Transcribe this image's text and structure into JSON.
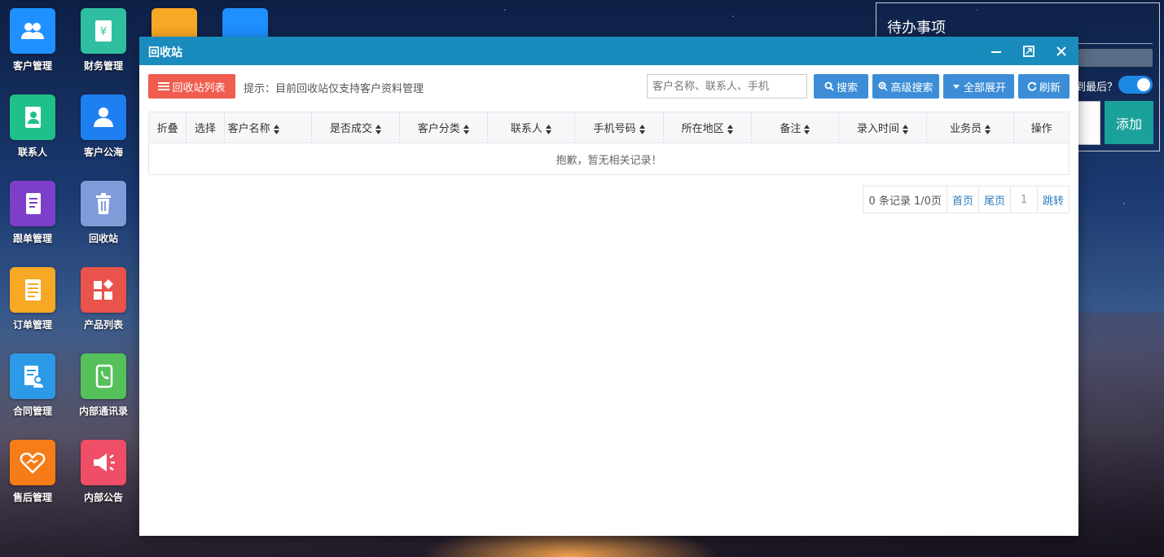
{
  "desktop": {
    "icons": [
      {
        "label": "客户管理",
        "icon": "customers-icon",
        "color": "#1e90ff"
      },
      {
        "label": "财务管理",
        "icon": "finance-icon",
        "color": "#2fbfa0"
      },
      {
        "label": "联系人",
        "icon": "contacts-icon",
        "color": "#20c08a"
      },
      {
        "label": "客户公海",
        "icon": "customer-pool-icon",
        "color": "#1e7ff0"
      },
      {
        "label": "跟单管理",
        "icon": "follow-up-icon",
        "color": "#7d3fc9"
      },
      {
        "label": "回收站",
        "icon": "trash-icon",
        "color": "#7e9cd8"
      },
      {
        "label": "订单管理",
        "icon": "orders-icon",
        "color": "#f7a825"
      },
      {
        "label": "产品列表",
        "icon": "products-icon",
        "color": "#e9534b"
      },
      {
        "label": "合同管理",
        "icon": "contract-icon",
        "color": "#2d9ae8"
      },
      {
        "label": "内部通讯录",
        "icon": "phonebook-icon",
        "color": "#56c15a"
      },
      {
        "label": "售后管理",
        "icon": "after-sales-icon",
        "color": "#f57c17"
      },
      {
        "label": "内部公告",
        "icon": "announcement-icon",
        "color": "#ee4e66"
      }
    ]
  },
  "todo": {
    "title": "待办事项",
    "question": "到最后？",
    "add_label": "添加",
    "toggle_on": true
  },
  "window": {
    "title": "回收站",
    "recycle_list_label": "回收站列表",
    "hint": "提示：目前回收站仅支持客户资料管理",
    "search_placeholder": "客户名称、联系人、手机",
    "buttons": {
      "search": "搜索",
      "advanced_search": "高级搜索",
      "expand_all": "全部展开",
      "refresh": "刷新"
    },
    "table": {
      "columns": [
        "折叠",
        "选择",
        "客户名称",
        "是否成交",
        "客户分类",
        "联系人",
        "手机号码",
        "所在地区",
        "备注",
        "录入时间",
        "业务员",
        "操作"
      ],
      "sortable": [
        false,
        false,
        true,
        true,
        true,
        true,
        true,
        true,
        true,
        true,
        true,
        false
      ],
      "empty_text": "抱歉，暂无相关记录！"
    },
    "pager": {
      "info": "0 条记录 1/0页",
      "first": "首页",
      "last": "尾页",
      "page": "1",
      "jump": "跳转"
    }
  },
  "colors": {
    "window_header": "#1a8bbd",
    "recycle_button": "#f05d4e",
    "primary_button": "#3c8dd6",
    "add_button": "#1aa19a"
  }
}
